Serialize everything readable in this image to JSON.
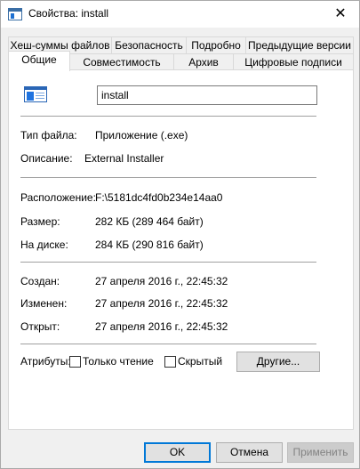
{
  "window": {
    "title": "Свойства: install",
    "close_glyph": "✕"
  },
  "tabs": {
    "row1": [
      {
        "label": "Хеш-суммы файлов"
      },
      {
        "label": "Безопасность"
      },
      {
        "label": "Подробно"
      },
      {
        "label": "Предыдущие версии"
      }
    ],
    "row2": [
      {
        "label": "Общие",
        "active": true
      },
      {
        "label": "Совместимость"
      },
      {
        "label": "Архив"
      },
      {
        "label": "Цифровые подписи"
      }
    ]
  },
  "general": {
    "file_name": "install",
    "file_type_label": "Тип файла:",
    "file_type_value": "Приложение (.exe)",
    "description_label": "Описание:",
    "description_value": "External Installer",
    "location_label": "Расположение:",
    "location_value": "F:\\5181dc4fd0b234e14aa0",
    "size_label": "Размер:",
    "size_value": "282 КБ (289 464 байт)",
    "disk_size_label": "На диске:",
    "disk_size_value": "284 КБ (290 816 байт)",
    "created_label": "Создан:",
    "created_value": "27 апреля 2016 г., 22:45:32",
    "modified_label": "Изменен:",
    "modified_value": "27 апреля 2016 г., 22:45:32",
    "accessed_label": "Открыт:",
    "accessed_value": "27 апреля 2016 г., 22:45:32",
    "attributes_label": "Атрибуты:",
    "readonly_label": "Только чтение",
    "readonly_checked": false,
    "hidden_label": "Скрытый",
    "hidden_checked": false,
    "other_button": "Другие..."
  },
  "footer": {
    "ok": "OK",
    "cancel": "Отмена",
    "apply": "Применить"
  }
}
